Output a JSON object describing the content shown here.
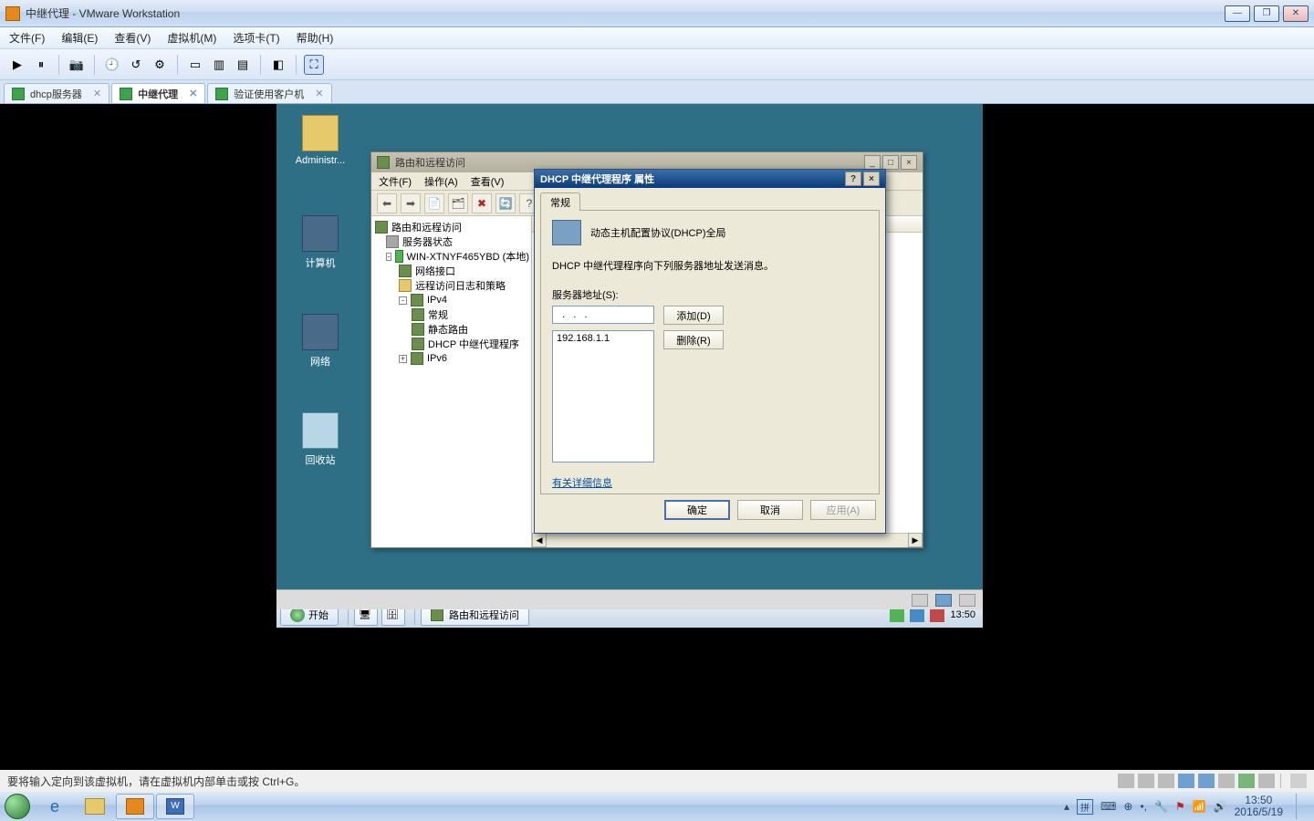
{
  "outer": {
    "title": "中继代理 - VMware Workstation",
    "menus": [
      "文件(F)",
      "编辑(E)",
      "查看(V)",
      "虚拟机(M)",
      "选项卡(T)",
      "帮助(H)"
    ]
  },
  "tabs": [
    {
      "label": "dhcp服务器",
      "active": false
    },
    {
      "label": "中继代理",
      "active": true
    },
    {
      "label": "验证使用客户机",
      "active": false
    }
  ],
  "desktop": {
    "icons": [
      "Administr...",
      "计算机",
      "网络",
      "回收站"
    ]
  },
  "mmc": {
    "title": "路由和远程访问",
    "menus": [
      "文件(F)",
      "操作(A)",
      "查看(V)"
    ],
    "tree": {
      "root": "路由和远程访问",
      "status": "服务器状态",
      "server": "WIN-XTNYF465YBD (本地)",
      "iface": "网络接口",
      "remote": "远程访问日志和策略",
      "ipv4": "IPv4",
      "general": "常规",
      "static": "静态路由",
      "dhcprelay": "DHCP 中继代理程序",
      "ipv6": "IPv6"
    }
  },
  "dlg": {
    "title": "DHCP 中继代理程序 属性",
    "tab": "常规",
    "heading": "动态主机配置协议(DHCP)全局",
    "desc": "DHCP 中继代理程序向下列服务器地址发送消息。",
    "label_addr": "服务器地址(S):",
    "btn_add": "添加(D)",
    "btn_del": "删除(R)",
    "list_item": "192.168.1.1",
    "more": "有关详细信息",
    "ok": "确定",
    "cancel": "取消",
    "apply": "应用(A)"
  },
  "guest_taskbar": {
    "start": "开始",
    "app": "路由和远程访问",
    "clock": "13:50"
  },
  "host_status": {
    "msg": "要将输入定向到该虚拟机，请在虚拟机内部单击或按 Ctrl+G。"
  },
  "host_taskbar": {
    "clock": "13:50",
    "date": "2016/5/19"
  }
}
